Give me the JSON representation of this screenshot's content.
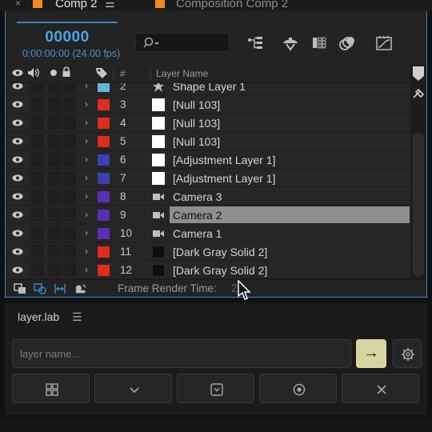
{
  "tabs": {
    "close_glyph": "×",
    "active_label": "Comp 2",
    "menu_glyph": "☰",
    "inactive_label": "Composition Comp 2",
    "tab_color": "#f08c1e"
  },
  "header": {
    "timecode": "00000",
    "subtime": "0:00:00:00 (24.00 fps)",
    "search_glyph": "ρ▾",
    "icons": [
      "comp-flowchart-icon",
      "draft-3d-icon",
      "frame-blending-icon",
      "motion-blur-icon",
      "graph-editor-icon"
    ]
  },
  "columns": {
    "number": "#",
    "layer_name": "Layer Name"
  },
  "layers": [
    {
      "number": "2",
      "name": "Shape Layer 1",
      "label_color": "#66b3d6",
      "type": "shape",
      "selected": false
    },
    {
      "number": "3",
      "name": "[Null 103]",
      "label_color": "#e02b20",
      "type": "null",
      "selected": false
    },
    {
      "number": "4",
      "name": "[Null 103]",
      "label_color": "#e02b20",
      "type": "null",
      "selected": false
    },
    {
      "number": "5",
      "name": "[Null 103]",
      "label_color": "#e02b20",
      "type": "null",
      "selected": false
    },
    {
      "number": "6",
      "name": "[Adjustment Layer 1]",
      "label_color": "#3a40b0",
      "type": "adjustment",
      "selected": false
    },
    {
      "number": "7",
      "name": "[Adjustment Layer 1]",
      "label_color": "#3a40b0",
      "type": "adjustment",
      "selected": false
    },
    {
      "number": "8",
      "name": "Camera 3",
      "label_color": "#5b2fb5",
      "type": "camera",
      "selected": false
    },
    {
      "number": "9",
      "name": "Camera 2",
      "label_color": "#5b2fb5",
      "type": "camera",
      "selected": true
    },
    {
      "number": "10",
      "name": "Camera 1",
      "label_color": "#5b2fb5",
      "type": "camera",
      "selected": false
    },
    {
      "number": "11",
      "name": "[Dark Gray Solid 2]",
      "label_color": "#e02b20",
      "type": "solid",
      "selected": false
    },
    {
      "number": "12",
      "name": "[Dark Gray Solid 2]",
      "label_color": "#e02b20",
      "type": "solid",
      "selected": false
    }
  ],
  "footer": {
    "frame_render_label": "Frame Render Time:",
    "frame_render_value": "2",
    "icons": [
      "comp-toggle-icon",
      "transfer-controls-icon",
      "in-out-icon",
      "draft-icon"
    ]
  },
  "layerlab": {
    "title": "layer.lab",
    "menu_glyph": "☰",
    "input_placeholder": "layer name...",
    "input_value": "",
    "go_label": "→",
    "accent": "#d8d6a0",
    "buttons": [
      "grid-icon",
      "chevron-down-icon",
      "checkbox-chevron-icon",
      "target-icon",
      "close-icon"
    ]
  }
}
